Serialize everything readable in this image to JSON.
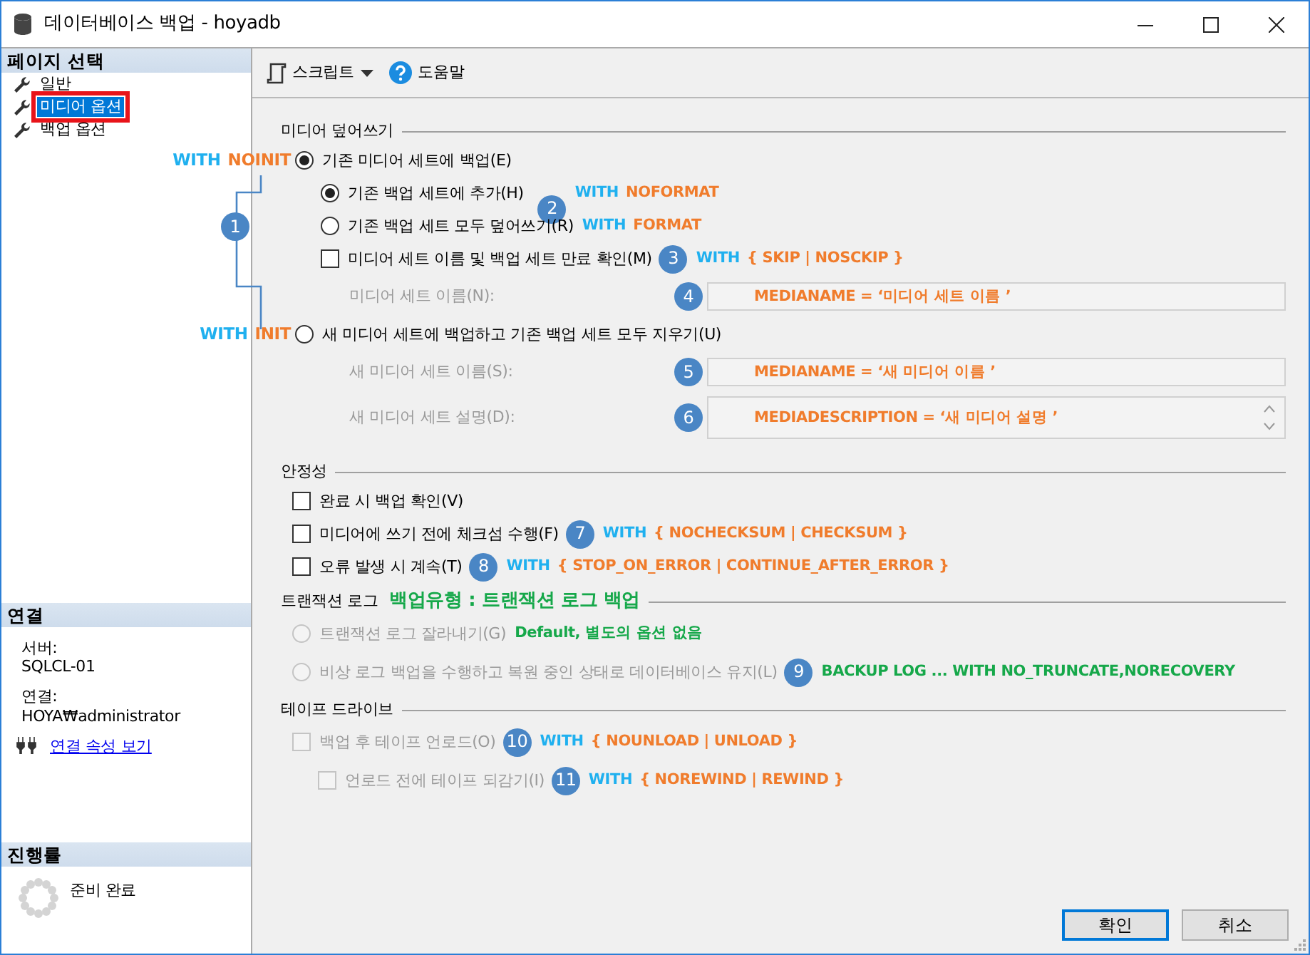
{
  "window": {
    "title": "데이터베이스 백업 - hoyadb"
  },
  "sidebar": {
    "page_select": {
      "title": "페이지 선택",
      "items": [
        {
          "label": "일반",
          "selected": false,
          "outlined": false
        },
        {
          "label": "미디어 옵션",
          "selected": true,
          "outlined": true
        },
        {
          "label": "백업 옵션",
          "selected": false,
          "outlined": false
        }
      ]
    },
    "connection": {
      "title": "연결",
      "server_label": "서버:",
      "server": "SQLCL-01",
      "connection_label": "연결:",
      "connection": "HOYA₩administrator",
      "link": "연결 속성 보기"
    },
    "progress": {
      "title": "진행률",
      "status": "준비 완료"
    }
  },
  "toolbar": {
    "script": "스크립트",
    "help": "도움말"
  },
  "sections": [
    {
      "title": "미디어 덮어쓰기",
      "callout": "1",
      "rows": [
        {
          "kind": "radio",
          "label": "기존 미디어 세트에 백업(E)",
          "selected": true,
          "disabled": false,
          "pre_note": [
            {
              "text": "WITH",
              "color": "#1fb0ef"
            },
            {
              "text": "NOINIT",
              "color": "#f07c2c"
            }
          ],
          "children": [
            {
              "kind": "radio",
              "label": "기존 백업 세트에 추가(H)",
              "selected": true,
              "disabled": false,
              "badge": "2",
              "note": [
                {
                  "text": "WITH",
                  "color": "#1fb0ef"
                },
                {
                  "text": "NOFORMAT",
                  "color": "#f07c2c"
                }
              ]
            },
            {
              "kind": "radio",
              "label": "기존 백업 세트 모두 덮어쓰기(R)",
              "selected": false,
              "disabled": false,
              "note": [
                {
                  "text": "WITH",
                  "color": "#1fb0ef"
                },
                {
                  "text": "FORMAT",
                  "color": "#f07c2c"
                }
              ]
            },
            {
              "kind": "checkbox",
              "label": "미디어 세트 이름 및 백업 세트 만료 확인(M)",
              "checked": false,
              "disabled": false,
              "badge": "3",
              "note": [
                {
                  "text": "WITH",
                  "color": "#1fb0ef"
                },
                {
                  "text": "{ SKIP | NOSCKIP }",
                  "color": "#f07c2c"
                }
              ]
            },
            {
              "kind": "field",
              "label": "미디어 세트 이름(N):",
              "disabled": true,
              "badge": "4",
              "note": [
                {
                  "text": "MEDIANAME = ‘미디어 세트 이름 ’",
                  "color": "#f07c2c"
                }
              ]
            }
          ]
        },
        {
          "kind": "radio",
          "label": "새 미디어 세트에 백업하고 기존 백업 세트 모두 지우기(U)",
          "selected": false,
          "disabled": false,
          "pre_note": [
            {
              "text": "WITH",
              "color": "#1fb0ef"
            },
            {
              "text": "INIT",
              "color": "#f07c2c"
            }
          ],
          "children": [
            {
              "kind": "field",
              "label": "새 미디어 세트 이름(S):",
              "disabled": true,
              "badge": "5",
              "note": [
                {
                  "text": "MEDIANAME = ‘새 미디어 이름 ’",
                  "color": "#f07c2c"
                }
              ]
            },
            {
              "kind": "textarea",
              "label": "새 미디어 세트 설명(D):",
              "disabled": true,
              "badge": "6",
              "note": [
                {
                  "text": "MEDIADESCRIPTION = ‘새 미디어 설명 ’",
                  "color": "#f07c2c"
                }
              ]
            }
          ]
        }
      ]
    },
    {
      "title": "안정성",
      "rows": [
        {
          "kind": "checkbox",
          "label": "완료 시 백업 확인(V)",
          "checked": false,
          "disabled": false
        },
        {
          "kind": "checkbox",
          "label": "미디어에 쓰기 전에 체크섬 수행(F)",
          "checked": false,
          "disabled": false,
          "badge": "7",
          "note": [
            {
              "text": "WITH",
              "color": "#1fb0ef"
            },
            {
              "text": "{ NOCHECKSUM | CHECKSUM }",
              "color": "#f07c2c"
            }
          ]
        },
        {
          "kind": "checkbox",
          "label": "오류 발생 시 계속(T)",
          "checked": false,
          "disabled": false,
          "badge": "8",
          "note": [
            {
              "text": "WITH",
              "color": "#1fb0ef"
            },
            {
              "text": "{ STOP_ON_ERROR | CONTINUE_AFTER_ERROR }",
              "color": "#f07c2c"
            }
          ]
        }
      ]
    },
    {
      "title": "트랜잭션 로그",
      "title_note": [
        {
          "text": "백업유형 : 트랜잭션 로그 백업",
          "color": "#16a84a"
        }
      ],
      "rows": [
        {
          "kind": "radio",
          "label": "트랜잭션 로그 잘라내기(G)",
          "selected": false,
          "disabled": true,
          "note": [
            {
              "text": "Default, 별도의 옵션 없음",
              "color": "#16a84a"
            }
          ]
        },
        {
          "kind": "radio",
          "label": "비상 로그 백업을 수행하고 복원 중인 상태로 데이터베이스 유지(L)",
          "selected": false,
          "disabled": true,
          "badge": "9",
          "note": [
            {
              "text": "BACKUP LOG ... WITH NO_TRUNCATE,NORECOVERY",
              "color": "#16a84a"
            }
          ]
        }
      ]
    },
    {
      "title": "테이프 드라이브",
      "rows": [
        {
          "kind": "checkbox",
          "label": "백업 후 테이프 언로드(O)",
          "checked": false,
          "disabled": true,
          "badge": "10",
          "note": [
            {
              "text": "WITH",
              "color": "#1fb0ef"
            },
            {
              "text": "{ NOUNLOAD | UNLOAD }",
              "color": "#f07c2c"
            }
          ],
          "children": [
            {
              "kind": "checkbox",
              "label": "언로드 전에 테이프 되감기(I)",
              "checked": false,
              "disabled": true,
              "badge": "11",
              "note": [
                {
                  "text": "WITH",
                  "color": "#1fb0ef"
                },
                {
                  "text": "{ NOREWIND | REWIND }",
                  "color": "#f07c2c"
                }
              ]
            }
          ]
        }
      ]
    }
  ],
  "buttons": [
    {
      "label": "확인",
      "default": true
    },
    {
      "label": "취소",
      "default": false
    }
  ]
}
